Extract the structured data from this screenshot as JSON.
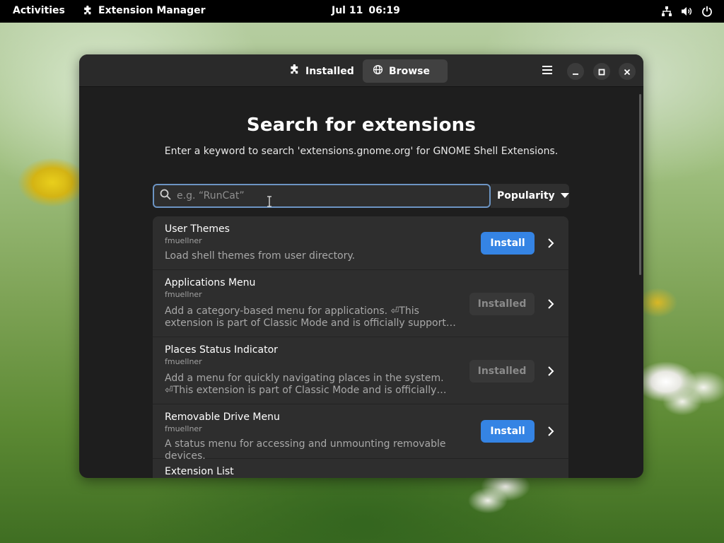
{
  "topbar": {
    "activities": "Activities",
    "app_name": "Extension Manager",
    "app_icon": "puzzle-icon",
    "date": "Jul 11",
    "time": "06:19",
    "tray_icons": [
      "network-icon",
      "volume-icon",
      "power-icon"
    ]
  },
  "window": {
    "tabs": [
      {
        "label": "Installed",
        "icon": "puzzle-icon",
        "active": false
      },
      {
        "label": "Browse",
        "icon": "globe-icon",
        "active": true
      }
    ],
    "controls": [
      "hamburger-menu-icon",
      "minimize-icon",
      "maximize-icon",
      "close-icon"
    ]
  },
  "browse": {
    "title": "Search for extensions",
    "subtitle": "Enter a keyword to search 'extensions.gnome.org' for GNOME Shell Extensions.",
    "search": {
      "placeholder": "e.g. “RunCat”",
      "value": ""
    },
    "sort": {
      "selected": "Popularity"
    },
    "results": [
      {
        "name": "User Themes",
        "author": "fmuellner",
        "description": "Load shell themes from user directory.",
        "action": "Install",
        "installed": false
      },
      {
        "name": "Applications Menu",
        "author": "fmuellner",
        "description": "Add a category-based menu for applications. ⏎This extension is part of Classic Mode and is officially supported by GNOME. Pl…",
        "action": "Installed",
        "installed": true
      },
      {
        "name": "Places Status Indicator",
        "author": "fmuellner",
        "description": "Add a menu for quickly navigating places in the system. ⏎This extension is part of Classic Mode and is officially supported by…",
        "action": "Installed",
        "installed": true
      },
      {
        "name": "Removable Drive Menu",
        "author": "fmuellner",
        "description": "A status menu for accessing and unmounting removable devices.",
        "action": "Install",
        "installed": false
      },
      {
        "name": "Extension List",
        "author": "",
        "description": "",
        "action": "",
        "installed": false
      }
    ]
  },
  "colors": {
    "accent": "#3584e4",
    "window_bg": "#1e1e1e",
    "headerbar_bg": "#2a2a2a",
    "list_bg": "#2e2e2e",
    "focus_border": "#6c94c3"
  }
}
